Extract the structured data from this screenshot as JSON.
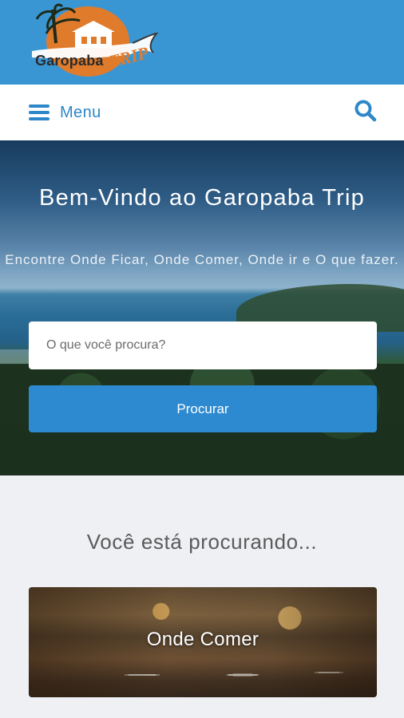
{
  "brand": {
    "logo_text": "Garopaba",
    "logo_trip": "TRIP",
    "bar_color": "#3a96d3"
  },
  "nav": {
    "menu_label": "Menu",
    "menu_icon": "hamburger-icon",
    "search_icon": "search-icon",
    "accent": "#2d87c8"
  },
  "hero": {
    "title": "Bem-Vindo ao Garopaba Trip",
    "subtitle": "Encontre Onde Ficar, Onde Comer, Onde ir e O que fazer.",
    "search_placeholder": "O que você procura?",
    "search_value": "",
    "submit_label": "Procurar",
    "button_color": "#2d8ad0"
  },
  "section": {
    "title": "Você está procurando...",
    "cards": [
      {
        "label": "Onde Comer"
      }
    ]
  }
}
